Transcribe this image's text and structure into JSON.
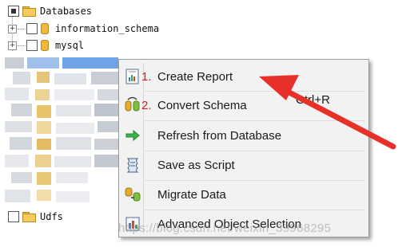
{
  "tree": {
    "root_label": "Databases",
    "items": [
      {
        "label": "information_schema",
        "expander": "+"
      },
      {
        "label": "mysql",
        "expander": "+"
      }
    ],
    "bottom_label": "Udfs"
  },
  "context_menu": {
    "items": [
      {
        "label": "Create Report",
        "number": "1.",
        "icon": "report-icon"
      },
      {
        "label": "Convert Schema",
        "number": "2.",
        "icon": "convert-schema-icon"
      },
      {
        "label": "Refresh from Database",
        "number": "",
        "icon": "refresh-arrow-icon"
      },
      {
        "label": "Save as Script",
        "number": "",
        "icon": "script-icon"
      },
      {
        "label": "Migrate Data",
        "number": "",
        "icon": "migrate-data-icon"
      },
      {
        "label": "Advanced Object Selection",
        "number": "",
        "icon": "object-selection-icon"
      }
    ],
    "convert_schema_shortcut": "Ctrl+R"
  },
  "annotation": {
    "arrow_color": "#e8302a",
    "number_color": "#d81c1c"
  },
  "watermark": "https://blog.csdn.net/weixin_39968295"
}
